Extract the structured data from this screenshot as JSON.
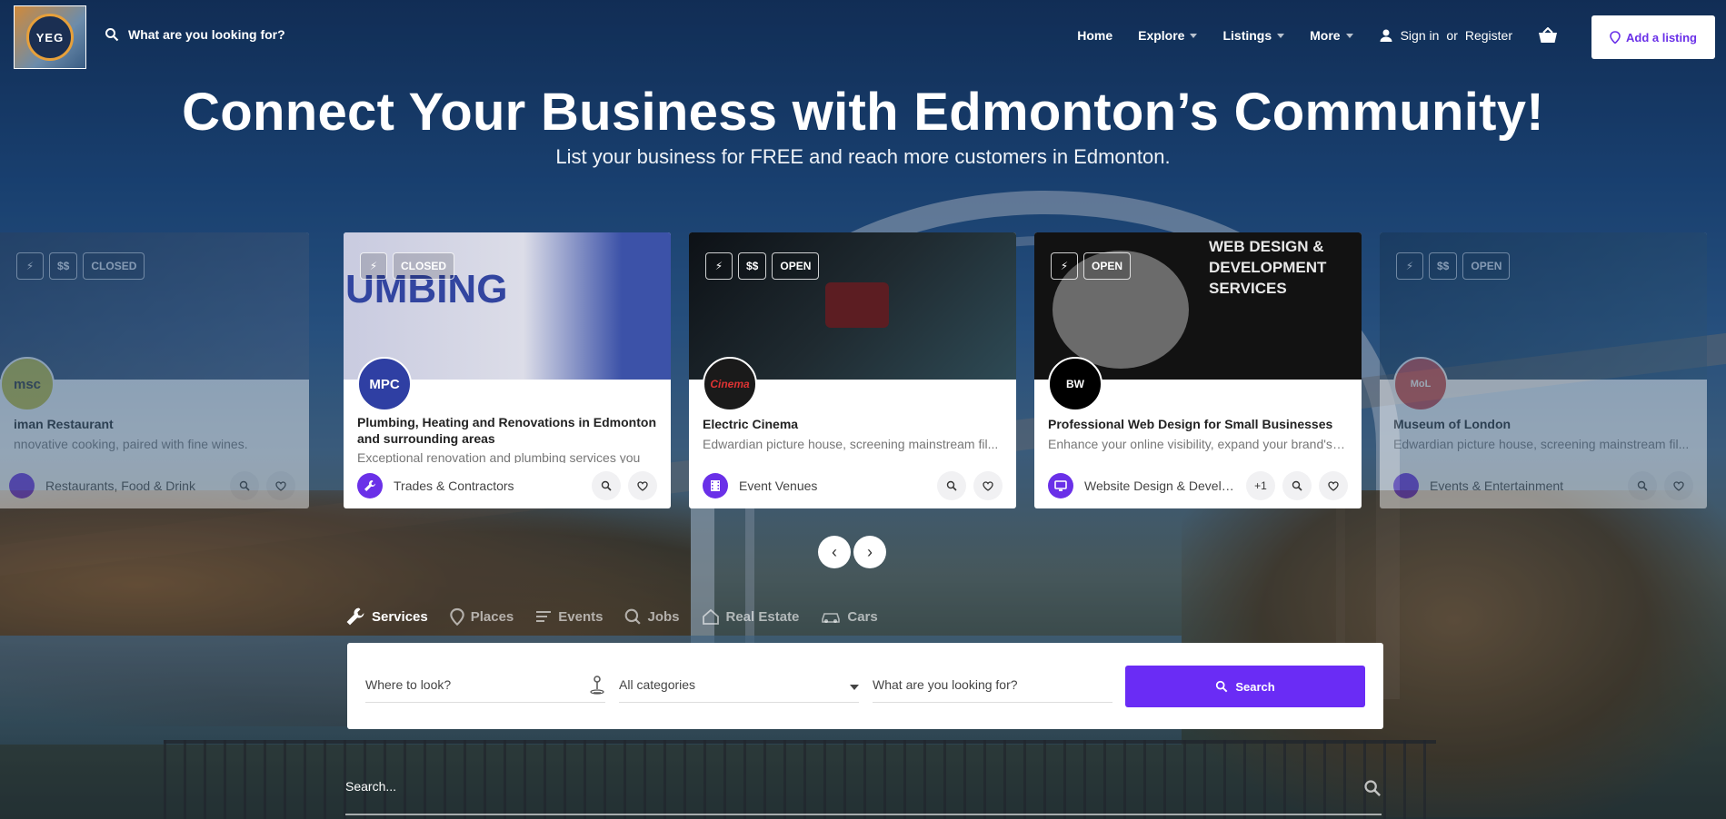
{
  "header": {
    "logo_text": "YEG",
    "search_placeholder": "What are you looking for?",
    "nav": [
      {
        "label": "Home"
      },
      {
        "label": "Explore"
      },
      {
        "label": "Listings"
      },
      {
        "label": "More"
      }
    ],
    "sign_in": "Sign in",
    "or": "or",
    "register": "Register",
    "add_listing": "Add a listing"
  },
  "hero": {
    "title": "Connect Your Business with Edmonton’s Community!",
    "subtitle": "List your business for FREE and reach more customers in Edmonton."
  },
  "cards": [
    {
      "badges": [
        "⚡",
        "$$",
        "CLOSED"
      ],
      "avatar": "msc",
      "title": "iman Restaurant",
      "desc": "nnovative cooking, paired with fine wines.",
      "category": "Restaurants, Food & Drink"
    },
    {
      "badges": [
        "⚡",
        "CLOSED"
      ],
      "avatar": "MPC",
      "title": "Plumbing, Heating and Renovations in Edmonton and surrounding areas",
      "desc": "Exceptional renovation and plumbing services you",
      "category": "Trades & Contractors",
      "image_text": "UMBING"
    },
    {
      "badges": [
        "⚡",
        "$$",
        "OPEN"
      ],
      "avatar": "Cinema",
      "title": "Electric Cinema",
      "desc": "Edwardian picture house, screening mainstream fil...",
      "category": "Event Venues"
    },
    {
      "badges": [
        "⚡",
        "OPEN"
      ],
      "avatar": "BW",
      "title": "Professional Web Design for Small Businesses",
      "desc": "Enhance your online visibility, expand your brand's r...",
      "category": "Website Design & Develo...",
      "extra": "+1",
      "image_text": "WEB DESIGN & DEVELOPMENT SERVICES"
    },
    {
      "badges": [
        "⚡",
        "$$",
        "OPEN"
      ],
      "avatar": "MoL",
      "title": "Museum of London",
      "desc": "Edwardian picture house, screening mainstream fil...",
      "category": "Events & Entertainment"
    }
  ],
  "carousel": {
    "prev": "‹",
    "next": "›"
  },
  "tabs": [
    {
      "label": "Services"
    },
    {
      "label": "Places"
    },
    {
      "label": "Events"
    },
    {
      "label": "Jobs"
    },
    {
      "label": "Real Estate"
    },
    {
      "label": "Cars"
    }
  ],
  "search": {
    "where_placeholder": "Where to look?",
    "category_value": "All categories",
    "what_placeholder": "What are you looking for?",
    "button": "Search",
    "bottom_placeholder": "Search..."
  },
  "colors": {
    "accent": "#6a2cf5",
    "white": "#ffffff"
  }
}
